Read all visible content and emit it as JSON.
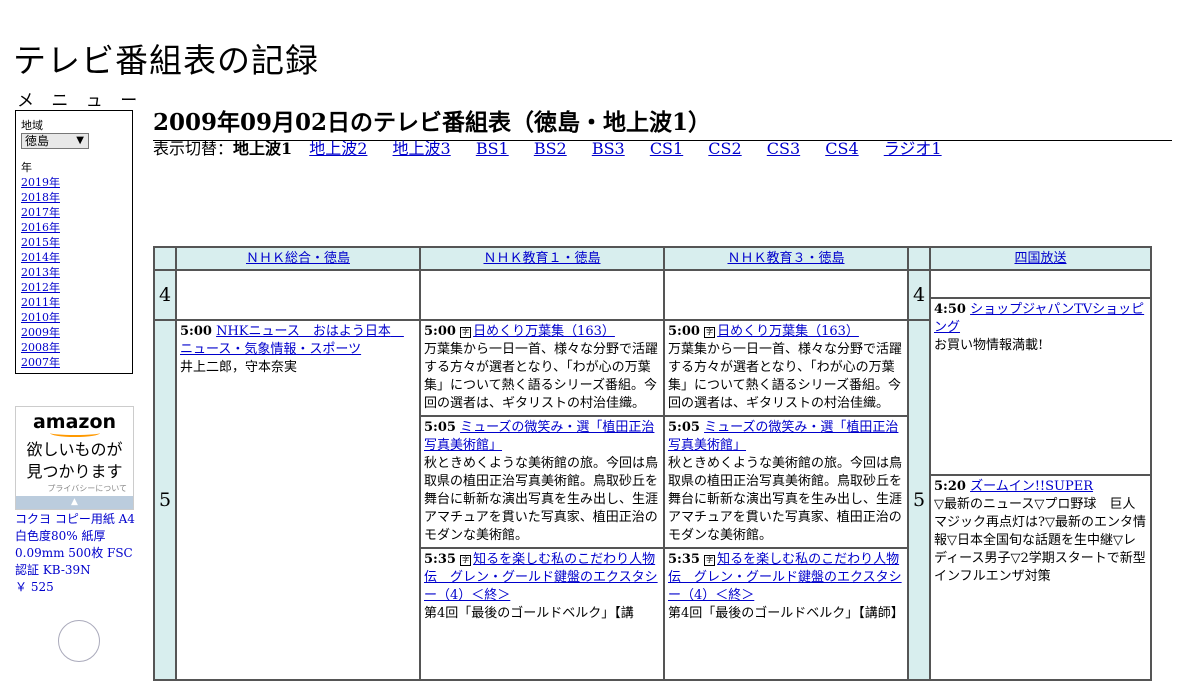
{
  "site": {
    "title": "テレビ番組表の記録"
  },
  "menu": {
    "heading": "メ ニ ュ ー",
    "region_label": "地域",
    "region_value": "徳島",
    "year_label": "年",
    "years": [
      "2019年",
      "2018年",
      "2017年",
      "2016年",
      "2015年",
      "2014年",
      "2013年",
      "2012年",
      "2011年",
      "2010年",
      "2009年",
      "2008年",
      "2007年"
    ]
  },
  "ad": {
    "logo": "amazon",
    "copy_line1": "欲しいものが",
    "copy_line2": "見つかります",
    "privacy": "プライバシーについて",
    "product_desc": "コクヨ コピー用紙 A4 白色度80% 紙厚 0.09mm 500枚 FSC認証 KB-39N",
    "product_price": "￥ 525"
  },
  "page": {
    "heading": "2009年09月02日のテレビ番組表（徳島・地上波1）",
    "switch_label": "表示切替：",
    "switch_current": "地上波1",
    "switch_links": [
      "地上波2",
      "地上波3",
      "BS1",
      "BS2",
      "BS3",
      "CS1",
      "CS2",
      "CS3",
      "CS4",
      "ラジオ1"
    ]
  },
  "grid": {
    "channels": [
      "ＮＨＫ総合・徳島",
      "ＮＨＫ教育１・徳島",
      "ＮＨＫ教育３・徳島",
      "四国放送"
    ],
    "hours": [
      "4",
      "5"
    ],
    "col1": [
      {
        "time": "5:00",
        "title": "NHKニュース　おはよう日本　ニュース・気象情報・スポーツ",
        "desc": "井上二郎，守本奈実"
      }
    ],
    "col2": [
      {
        "time": "5:00",
        "icon": "字",
        "title": "日めくり万葉集（163）",
        "desc": "万葉集から一日一首、様々な分野で活躍する方々が選者となり、「わが心の万葉集」について熱く語るシリーズ番組。今回の選者は、ギタリストの村治佳織。"
      },
      {
        "time": "5:05",
        "title": "ミューズの微笑み・選「植田正治写真美術館」",
        "desc": "秋ときめくような美術館の旅。今回は鳥取県の植田正治写真美術館。鳥取砂丘を舞台に斬新な演出写真を生み出し、生涯アマチュアを貫いた写真家、植田正治のモダンな美術館。"
      },
      {
        "time": "5:35",
        "icon": "字",
        "title": "知るを楽しむ私のこだわり人物伝　グレン・グールド鍵盤のエクスタシー（4）＜終＞",
        "desc": "第4回「最後のゴールドベルク」【講"
      }
    ],
    "col3": [
      {
        "time": "5:00",
        "icon": "字",
        "title": "日めくり万葉集（163）",
        "desc": "万葉集から一日一首、様々な分野で活躍する方々が選者となり、「わが心の万葉集」について熱く語るシリーズ番組。今回の選者は、ギタリストの村治佳織。"
      },
      {
        "time": "5:05",
        "title": "ミューズの微笑み・選「植田正治写真美術館」",
        "desc": "秋ときめくような美術館の旅。今回は鳥取県の植田正治写真美術館。鳥取砂丘を舞台に斬新な演出写真を生み出し、生涯アマチュアを貫いた写真家、植田正治のモダンな美術館。"
      },
      {
        "time": "5:35",
        "icon": "字",
        "title": "知るを楽しむ私のこだわり人物伝　グレン・グールド鍵盤のエクスタシー（4）＜終＞",
        "desc": "第4回「最後のゴールドベルク」【講師】"
      }
    ],
    "col4": [
      {
        "time": "4:50",
        "title": "ショップジャパンTVショッピング",
        "desc": "お買い物情報満載!"
      },
      {
        "time": "5:20",
        "title": "ズームイン!!SUPER",
        "desc": "▽最新のニュース▽プロ野球　巨人マジック再点灯は?▽最新のエンタ情報▽日本全国旬な話題を生中継▽レディース男子▽2学期スタートで新型インフルエンザ対策"
      }
    ]
  }
}
